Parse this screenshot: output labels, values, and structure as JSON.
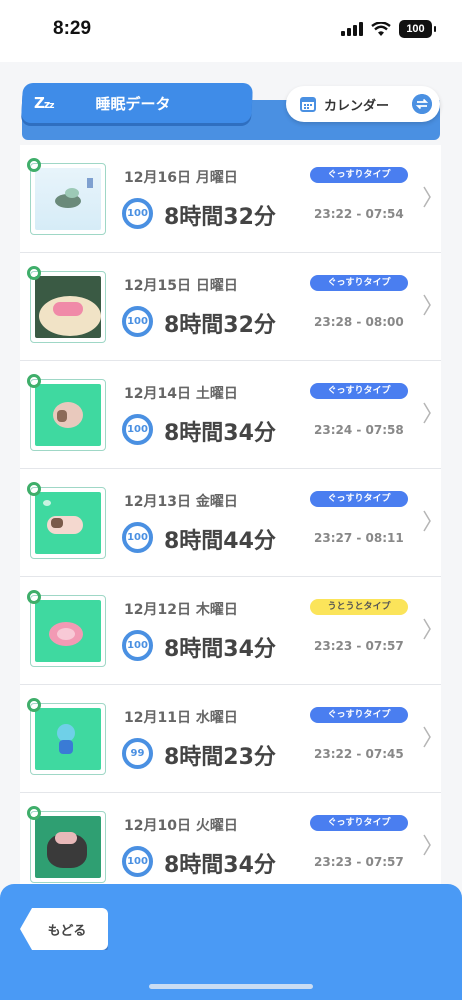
{
  "status": {
    "time": "8:29",
    "battery": "100"
  },
  "header": {
    "title": "睡眠データ",
    "zzz": "Z",
    "calendar_label": "カレンダー"
  },
  "rows": [
    {
      "date": "12月16日 月曜日",
      "type": "ぐっすりタイプ",
      "type_color": "#4a7ef0",
      "score": "100",
      "duration": "8時間32分",
      "range": "23:22 - 07:54"
    },
    {
      "date": "12月15日 日曜日",
      "type": "ぐっすりタイプ",
      "type_color": "#4a7ef0",
      "score": "100",
      "duration": "8時間32分",
      "range": "23:28 - 08:00"
    },
    {
      "date": "12月14日 土曜日",
      "type": "ぐっすりタイプ",
      "type_color": "#4a7ef0",
      "score": "100",
      "duration": "8時間34分",
      "range": "23:24 - 07:58"
    },
    {
      "date": "12月13日 金曜日",
      "type": "ぐっすりタイプ",
      "type_color": "#4a7ef0",
      "score": "100",
      "duration": "8時間44分",
      "range": "23:27 - 08:11"
    },
    {
      "date": "12月12日 木曜日",
      "type": "うとうとタイプ",
      "type_color": "#fbe45a",
      "score": "100",
      "duration": "8時間34分",
      "range": "23:23 - 07:57"
    },
    {
      "date": "12月11日 水曜日",
      "type": "ぐっすりタイプ",
      "type_color": "#4a7ef0",
      "score": "99",
      "duration": "8時間23分",
      "range": "23:22 - 07:45"
    },
    {
      "date": "12月10日 火曜日",
      "type": "ぐっすりタイプ",
      "type_color": "#4a7ef0",
      "score": "100",
      "duration": "8時間34分",
      "range": "23:23 - 07:57"
    }
  ],
  "footer": {
    "back_label": "もどる"
  },
  "colors": {
    "accent": "#4a90e2",
    "bottom_bar": "#4a9af5",
    "badge_blue": "#4a7ef0",
    "badge_yellow": "#fbe45a"
  },
  "icons": [
    "signal-icon",
    "wifi-icon",
    "battery-icon",
    "zzz-icon",
    "calendar-icon",
    "swap-icon",
    "chevron-right-icon",
    "clip-icon"
  ]
}
